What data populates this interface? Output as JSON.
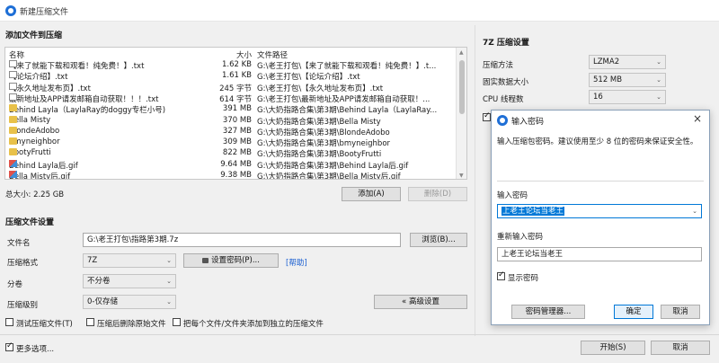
{
  "window": {
    "title": "新建压缩文件"
  },
  "add_files": {
    "section_title": "添加文件到压缩",
    "columns": {
      "name": "名称",
      "size": "大小",
      "path": "文件路径"
    },
    "rows": [
      {
        "icon": "text-file-icon",
        "name": "【来了就能下载和观看！纯免费！】.txt",
        "size": "1.62 KB",
        "path": "G:\\老王打包\\【来了就能下载和观看！纯免费！】.t..."
      },
      {
        "icon": "text-file-icon",
        "name": "【论坛介绍】.txt",
        "size": "1.61 KB",
        "path": "G:\\老王打包\\【论坛介绍】.txt"
      },
      {
        "icon": "text-file-icon",
        "name": "【永久地址发布页】.txt",
        "size": "245 字节",
        "path": "G:\\老王打包\\【永久地址发布页】.txt"
      },
      {
        "icon": "text-file-icon",
        "name": "最新地址及APP请发邮箱自动获取！！！.txt",
        "size": "614 字节",
        "path": "G:\\老王打包\\最新地址及APP请发邮箱自动获取！..."
      },
      {
        "icon": "folder-icon",
        "name": "Behind Layla（LaylaRay的doggy专栏小号)",
        "size": "391 MB",
        "path": "G:\\大奶指路合集\\第3期\\Behind Layla（LaylaRay..."
      },
      {
        "icon": "folder-icon",
        "name": "Bella Misty",
        "size": "370 MB",
        "path": "G:\\大奶指路合集\\第3期\\Bella Misty"
      },
      {
        "icon": "folder-icon",
        "name": "BlondeAdobo",
        "size": "327 MB",
        "path": "G:\\大奶指路合集\\第3期\\BlondeAdobo"
      },
      {
        "icon": "folder-icon",
        "name": "bmyneighbor",
        "size": "309 MB",
        "path": "G:\\大奶指路合集\\第3期\\bmyneighbor"
      },
      {
        "icon": "folder-icon",
        "name": "BootyFrutti",
        "size": "822 MB",
        "path": "G:\\大奶指路合集\\第3期\\BootyFrutti"
      },
      {
        "icon": "image-file-icon",
        "name": "Behind Layla后.gif",
        "size": "9.64 MB",
        "path": "G:\\大奶指路合集\\第3期\\Behind Layla后.gif"
      },
      {
        "icon": "image-file-icon",
        "name": "Bella Misty后.gif",
        "size": "9.38 MB",
        "path": "G:\\大奶指路合集\\第3期\\Bella Misty后.gif"
      }
    ],
    "total_size": "总大小: 2.25 GB",
    "add_button": "添加(A)",
    "remove_button": "删除(D)"
  },
  "compress_settings": {
    "section_title": "压缩文件设置",
    "filename_label": "文件名",
    "filename_value": "G:\\老王打包\\指路第3期.7z",
    "browse_button": "浏览(B)...",
    "format_label": "压缩格式",
    "format_value": "7Z",
    "set_password_button": "设置密码(P)...",
    "help_link": "[帮助]",
    "split_label": "分卷",
    "split_value": "不分卷",
    "level_label": "压缩级别",
    "level_value": "0-仅存储",
    "advanced_button": "« 高级设置",
    "test_archive": "测试压缩文件(T)",
    "delete_after": "压缩后删除原始文件",
    "separate_archives": "把每个文件/文件夹添加到独立的压缩文件"
  },
  "sevenzip": {
    "section_title": "7Z 压缩设置",
    "method_label": "压缩方法",
    "method_value": "LZMA2",
    "dict_label": "固实数据大小",
    "dict_value": "512 MB",
    "threads_label": "CPU 线程数",
    "threads_value": "16"
  },
  "footer": {
    "more_options": "更多选项...",
    "start_button": "开始(S)",
    "cancel_button": "取消"
  },
  "password_dialog": {
    "title": "输入密码",
    "description": "输入压缩包密码。建议使用至少 8 位的密码来保证安全性。",
    "enter_label": "输入密码",
    "enter_value": "上老王论坛当老王",
    "reenter_label": "重新输入密码",
    "reenter_value": "上老王论坛当老王",
    "show_password": "显示密码",
    "manager_button": "密码管理器...",
    "ok_button": "确定",
    "cancel_button": "取消"
  },
  "colors": {
    "accent": "#0078d7",
    "link": "#1a5fd1",
    "selection": "#cce4f7"
  }
}
